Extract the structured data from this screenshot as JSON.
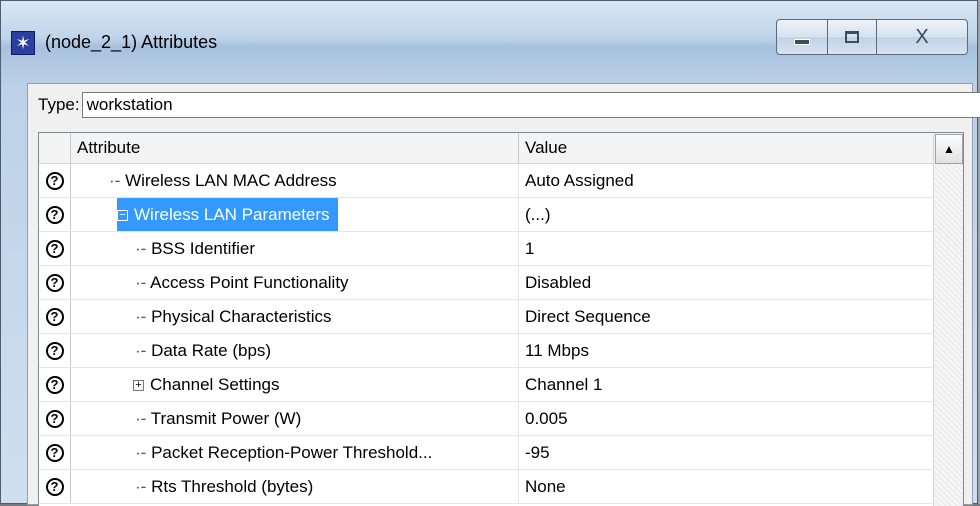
{
  "window": {
    "title": "(node_2_1) Attributes",
    "close_glyph": "X"
  },
  "type": {
    "label": "Type:",
    "value": "workstation"
  },
  "grid": {
    "columns": {
      "attribute": "Attribute",
      "value": "Value"
    },
    "rows": [
      {
        "attr": "Wireless LAN MAC Address",
        "value": "Auto Assigned"
      },
      {
        "attr": "Wireless LAN Parameters",
        "value": "(...)"
      },
      {
        "attr": "BSS Identifier",
        "value": "1"
      },
      {
        "attr": "Access Point Functionality",
        "value": "Disabled"
      },
      {
        "attr": "Physical Characteristics",
        "value": "Direct Sequence"
      },
      {
        "attr": "Data Rate (bps)",
        "value": "11 Mbps"
      },
      {
        "attr": "Channel Settings",
        "value": "Channel 1"
      },
      {
        "attr": "Transmit Power (W)",
        "value": "0.005"
      },
      {
        "attr": "Packet Reception-Power Threshold...",
        "value": "-95"
      },
      {
        "attr": "Rts Threshold (bytes)",
        "value": "None"
      }
    ]
  },
  "icons": {
    "app": "workstation-app-icon",
    "help": "help-icon",
    "collapse": "minus-box-icon",
    "expand": "plus-box-icon"
  }
}
